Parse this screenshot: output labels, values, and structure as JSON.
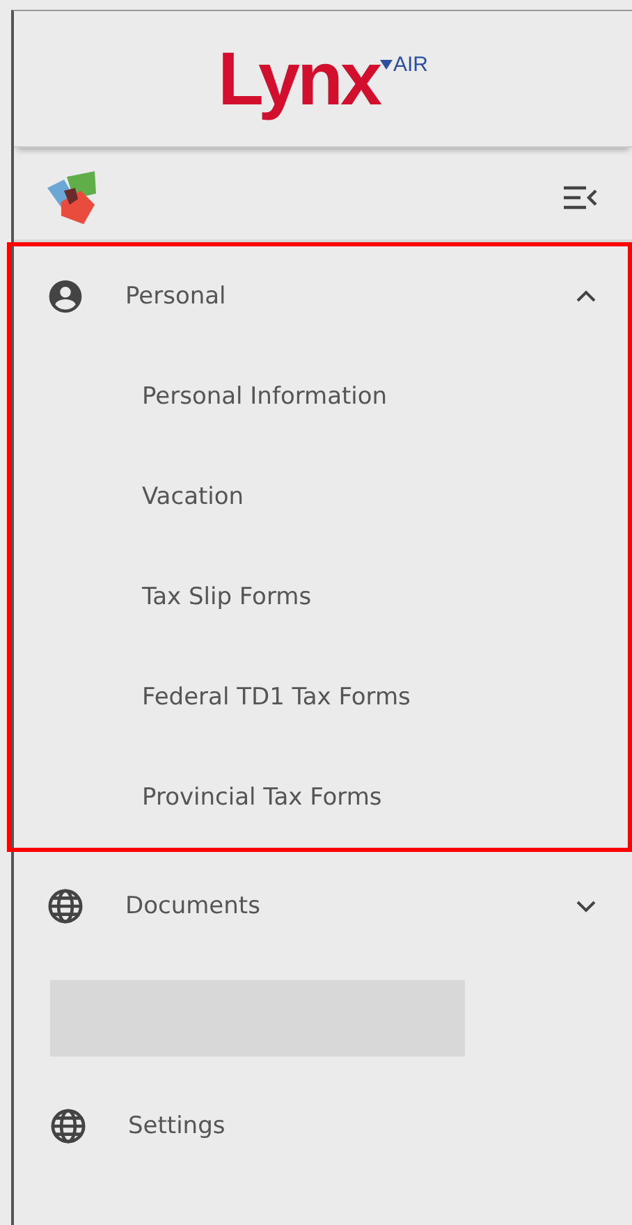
{
  "header": {
    "logo_text": "Lynx",
    "logo_suffix": "AIR"
  },
  "menu": [
    {
      "kind": "group",
      "label": "Personal",
      "expanded": true,
      "highlighted": true,
      "children": [
        {
          "label": "Personal Information"
        },
        {
          "label": "Vacation"
        },
        {
          "label": "Tax Slip Forms"
        },
        {
          "label": "Federal TD1 Tax Forms"
        },
        {
          "label": "Provincial Tax Forms"
        }
      ]
    },
    {
      "kind": "group",
      "label": "Documents",
      "expanded": false,
      "highlighted": false
    },
    {
      "kind": "blank"
    },
    {
      "kind": "link",
      "label": "Settings"
    }
  ]
}
